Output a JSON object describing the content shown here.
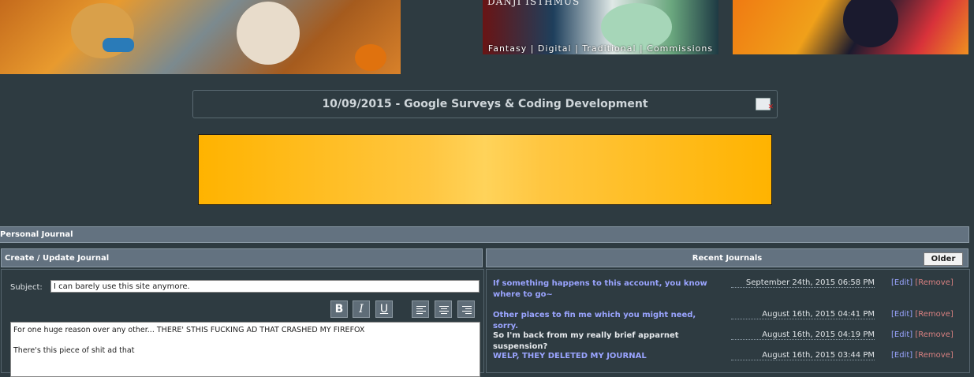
{
  "banners": {
    "middle": {
      "title": "DANJI ISTHMUS",
      "caption": "Fantasy | Digital | Traditional | Commissions"
    }
  },
  "journal_title": "10/09/2015 - Google Surveys & Coding Development",
  "personal_journal_header": "Personal Journal",
  "create_panel": {
    "header": "Create / Update Journal",
    "subject_label": "Subject:",
    "subject_value": "I can barely use this site anymore.",
    "bold_label": "B",
    "italic_label": "I",
    "underline_label": "U",
    "body_lines": [
      "For one huge reason over any other... THERE' STHIS FUCKING AD THAT CRASHED MY FIREFOX",
      "There's this piece of shit ad that"
    ]
  },
  "recent_panel": {
    "header": "Recent Journals",
    "older_label": "Older",
    "edit_label": "[Edit]",
    "remove_label": "[Remove]",
    "entries": [
      {
        "title": "If something happens to this account, you know where to go~",
        "date": "September 24th, 2015 06:58 PM"
      },
      {
        "title": "Other places to fin me which you might need, sorry.",
        "date": "August 16th, 2015 04:41 PM"
      },
      {
        "title": "So I'm back from my really brief apparnet suspension?",
        "date": "August 16th, 2015 04:19 PM"
      },
      {
        "title": "WELP, THEY DELETED MY JOURNAL",
        "date": "August 16th, 2015 03:44 PM"
      }
    ]
  },
  "colors": {
    "page_background": "#2e3b41",
    "panel_header": "#637280",
    "link": "#9aa4ff",
    "ad_orange": "#ffb300"
  },
  "icons": [
    "close-journal-icon",
    "align-left-icon",
    "align-center-icon",
    "align-right-icon"
  ]
}
